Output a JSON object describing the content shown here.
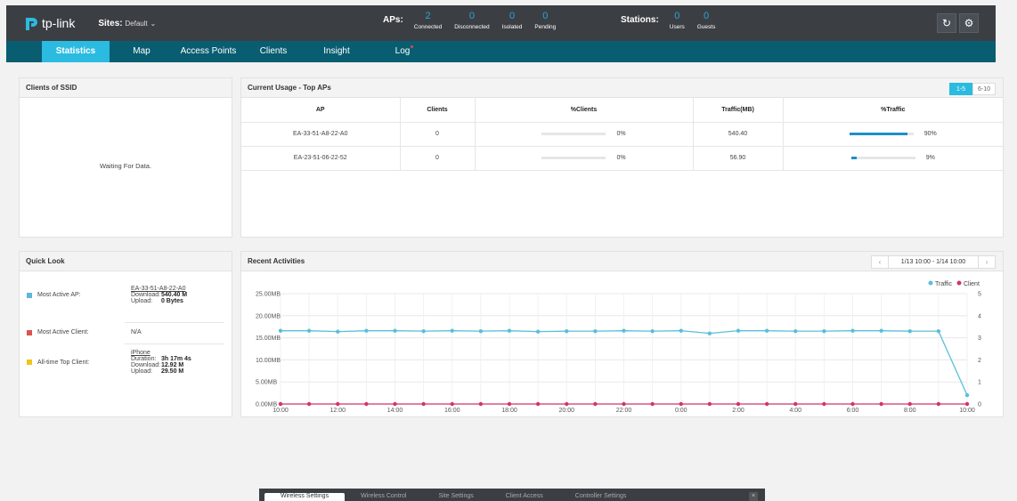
{
  "header": {
    "logo_text": "tp-link",
    "sites_label": "Sites:",
    "sites_value": "Default",
    "aps_label": "APs:",
    "aps_stats": [
      {
        "num": "2",
        "label": "Connected"
      },
      {
        "num": "0",
        "label": "Disconnected"
      },
      {
        "num": "0",
        "label": "Isolated"
      },
      {
        "num": "0",
        "label": "Pending"
      }
    ],
    "stations_label": "Stations:",
    "station_stats": [
      {
        "num": "0",
        "label": "Users"
      },
      {
        "num": "0",
        "label": "Guests"
      }
    ],
    "refresh_icon": "refresh-icon",
    "settings_icon": "gear-icon"
  },
  "tabs": [
    "Statistics",
    "Map",
    "Access Points",
    "Clients",
    "Insight",
    "Log"
  ],
  "clients_of_ssid": {
    "title": "Clients of SSID",
    "waiting": "Waiting For Data."
  },
  "top_aps": {
    "title": "Current Usage - Top APs",
    "pages": [
      "1-5",
      "6-10"
    ],
    "columns": [
      "AP",
      "Clients",
      "%Clients",
      "Traffic(MB)",
      "%Traffic"
    ],
    "rows": [
      {
        "ap": "EA-33-51-A8-22-A0",
        "clients": "0",
        "pct_clients": "0%",
        "pct_clients_frac": 0,
        "traffic": "540.40",
        "pct_traffic": "90%",
        "pct_traffic_frac": 0.9
      },
      {
        "ap": "EA-23-51-06-22-52",
        "clients": "0",
        "pct_clients": "0%",
        "pct_clients_frac": 0,
        "traffic": "56.90",
        "pct_traffic": "9%",
        "pct_traffic_frac": 0.09
      }
    ]
  },
  "quick_look": {
    "title": "Quick Look",
    "most_active_ap": {
      "label": "Most Active AP:",
      "name": "EA-33-51-A8-22-A0",
      "download_label": "Download:",
      "download": "540.40 M",
      "upload_label": "Upload:",
      "upload": "0 Bytes",
      "color": "#5bb8d8"
    },
    "most_active_client": {
      "label": "Most Active Client:",
      "value": "N/A",
      "color": "#d9534f"
    },
    "top_client": {
      "label": "All-time Top Client:",
      "name": "iPhone",
      "duration_label": "Duration:",
      "duration": "3h 17m 4s",
      "download_label": "Download:",
      "download": "12.92 M",
      "upload_label": "Upload:",
      "upload": "29.50 M",
      "color": "#f0c419"
    }
  },
  "recent": {
    "title": "Recent Activities",
    "range": "1/13 10:00 - 1/14 10:00",
    "legend_traffic": "Traffic",
    "legend_client": "Client"
  },
  "chart_data": {
    "type": "line",
    "title": "",
    "x": [
      "10:00",
      "11:00",
      "12:00",
      "13:00",
      "14:00",
      "15:00",
      "16:00",
      "17:00",
      "18:00",
      "19:00",
      "20:00",
      "21:00",
      "22:00",
      "23:00",
      "0:00",
      "1:00",
      "2:00",
      "3:00",
      "4:00",
      "5:00",
      "6:00",
      "7:00",
      "8:00",
      "9:00",
      "10:00"
    ],
    "x_tick_labels": [
      "10:00",
      "12:00",
      "14:00",
      "16:00",
      "18:00",
      "20:00",
      "22:00",
      "0:00",
      "2:00",
      "4:00",
      "6:00",
      "8:00",
      "10:00"
    ],
    "y_left_ticks": [
      "0.00MB",
      "5.00MB",
      "10.00MB",
      "15.00MB",
      "20.00MB",
      "25.00MB"
    ],
    "y_right_ticks": [
      "0",
      "1",
      "2",
      "3",
      "4",
      "5"
    ],
    "ylim_left": [
      0,
      25
    ],
    "ylim_right": [
      0,
      5
    ],
    "series": [
      {
        "name": "Traffic",
        "color": "#58c0d8",
        "axis": "left",
        "values": [
          16.6,
          16.6,
          16.4,
          16.6,
          16.6,
          16.5,
          16.6,
          16.5,
          16.6,
          16.4,
          16.5,
          16.5,
          16.6,
          16.5,
          16.6,
          16.0,
          16.6,
          16.6,
          16.5,
          16.5,
          16.6,
          16.6,
          16.5,
          16.5,
          2.0
        ]
      },
      {
        "name": "Client",
        "color": "#d0356a",
        "axis": "right",
        "values": [
          0,
          0,
          0,
          0,
          0,
          0,
          0,
          0,
          0,
          0,
          0,
          0,
          0,
          0,
          0,
          0,
          0,
          0,
          0,
          0,
          0,
          0,
          0,
          0,
          0
        ]
      }
    ]
  },
  "bottom_bar": [
    "Wireless Settings",
    "Wireless Control",
    "Site Settings",
    "Client Access",
    "Controller Settings"
  ]
}
